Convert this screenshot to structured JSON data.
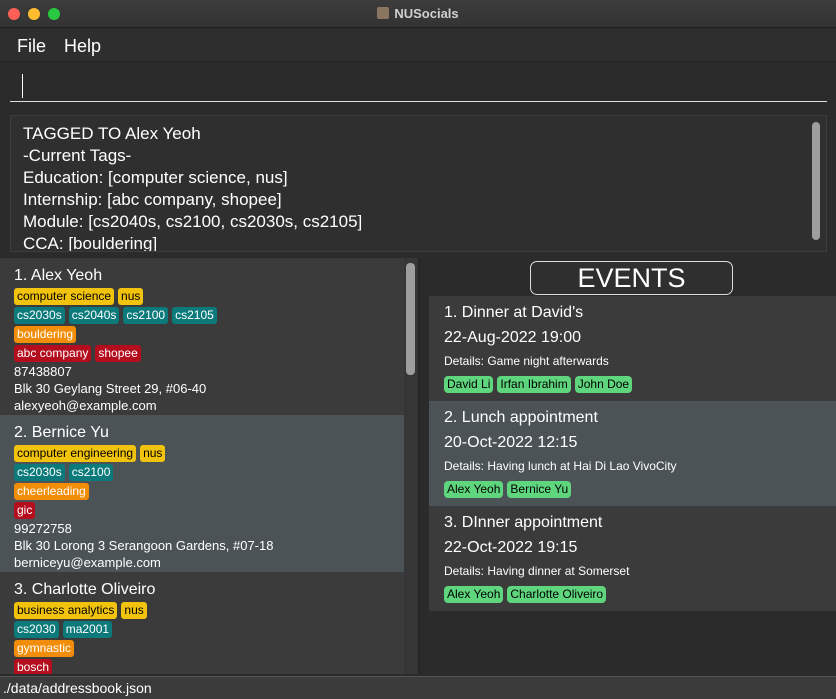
{
  "window": {
    "title": "NUSocials"
  },
  "menu": {
    "file": "File",
    "help": "Help"
  },
  "command": {
    "value": "",
    "placeholder": ""
  },
  "result": {
    "lines": [
      "TAGGED TO Alex Yeoh",
      "-Current Tags-",
      "Education: [computer science, nus]",
      "Internship: [abc company, shopee]",
      "Module: [cs2040s, cs2100, cs2030s, cs2105]",
      "CCA: [bouldering]"
    ]
  },
  "persons": [
    {
      "index": "1.",
      "name": "Alex Yeoh",
      "education": [
        "computer science",
        "nus"
      ],
      "modules": [
        "cs2030s",
        "cs2040s",
        "cs2100",
        "cs2105"
      ],
      "cca": [
        "bouldering"
      ],
      "internship": [
        "abc company",
        "shopee"
      ],
      "phone": "87438807",
      "address": "Blk 30 Geylang Street 29, #06-40",
      "email": "alexyeoh@example.com"
    },
    {
      "index": "2.",
      "name": "Bernice Yu",
      "education": [
        "computer engineering",
        "nus"
      ],
      "modules": [
        "cs2030s",
        "cs2100"
      ],
      "cca": [
        "cheerleading"
      ],
      "internship": [
        "gic"
      ],
      "phone": "99272758",
      "address": "Blk 30 Lorong 3 Serangoon Gardens, #07-18",
      "email": "berniceyu@example.com"
    },
    {
      "index": "3.",
      "name": "Charlotte Oliveiro",
      "education": [
        "business analytics",
        "nus"
      ],
      "modules": [
        "cs2030",
        "ma2001"
      ],
      "cca": [
        "gymnastic"
      ],
      "internship": [
        "bosch"
      ],
      "phone": "",
      "address": "",
      "email": ""
    }
  ],
  "events_title": "EVENTS",
  "events": [
    {
      "index": "1.",
      "name": "Dinner at David's",
      "date": "22-Aug-2022 19:00",
      "details": "Details: Game night afterwards",
      "participants": [
        "David Li",
        "Irfan Ibrahim",
        "John Doe"
      ]
    },
    {
      "index": "2.",
      "name": "Lunch appointment",
      "date": "20-Oct-2022 12:15",
      "details": "Details: Having lunch at Hai Di Lao VivoCity",
      "participants": [
        "Alex Yeoh",
        "Bernice Yu"
      ]
    },
    {
      "index": "3.",
      "name": "DInner appointment",
      "date": "22-Oct-2022 19:15",
      "details": "Details: Having dinner at Somerset",
      "participants": [
        "Alex Yeoh",
        "Charlotte Oliveiro"
      ]
    }
  ],
  "status": {
    "path": "./data/addressbook.json"
  },
  "colors": {
    "education_tag": "#f2c30d",
    "module_tag": "#0c7a7a",
    "cca_tag": "#f18d08",
    "internship_tag": "#b40d1e",
    "participant_tag": "#5fd67d"
  }
}
